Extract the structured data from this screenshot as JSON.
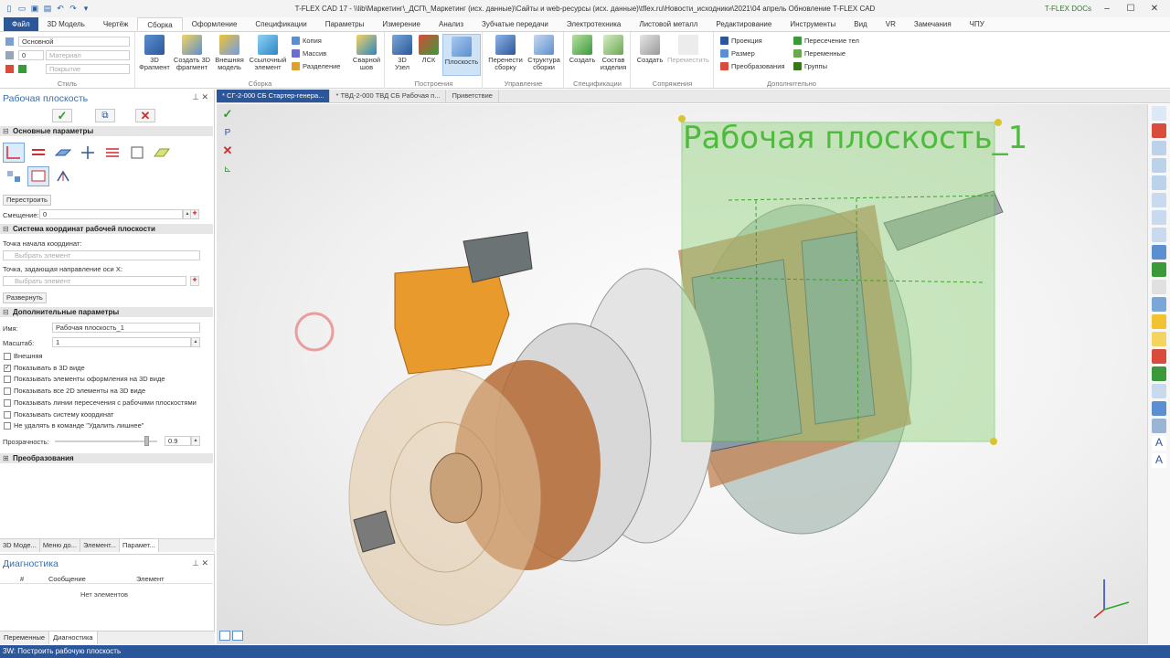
{
  "window": {
    "title": "T-FLEX CAD 17 - \\\\lib\\Маркетинг\\_ДСП\\_Маркетинг (исх. данные)\\Сайты и web-ресурсы (исх. данные)\\tflex.ru\\Новости_исходники\\2021\\04 апрель Обновление T-FLEX CAD",
    "docs_label": "T-FLEX DOCs",
    "min": "–",
    "max": "☐",
    "close": "✕"
  },
  "tabs": [
    "Файл",
    "3D Модель",
    "Чертёж",
    "Сборка",
    "Оформление",
    "Спецификации",
    "Параметры",
    "Измерение",
    "Анализ",
    "Зубчатые передачи",
    "Электротехника",
    "Листовой металл",
    "Редактирование",
    "Инструменты",
    "Вид",
    "VR",
    "Замечания",
    "ЧПУ"
  ],
  "ribbon": {
    "style": {
      "label": "Стиль",
      "layer": "Основной",
      "level": "0",
      "material": "Материал",
      "cover": "Покрытие"
    },
    "assembly": {
      "label": "Сборка",
      "fragment": "3D\nФрагмент",
      "create_fragment": "Создать 3D\nфрагмент",
      "external_model": "Внешняя\nмодель",
      "ref_element": "Ссылочный\nэлемент",
      "copy": "Копия",
      "array": "Массив",
      "split": "Разделение",
      "weld": "Сварной\nшов"
    },
    "constructions": {
      "label": "Построения",
      "node3d": "3D\nУзел",
      "lcs": "ЛСК",
      "plane": "Плоскость"
    },
    "management": {
      "label": "Управление",
      "move": "Перенести\nсборку",
      "structure": "Структура\nсборки"
    },
    "specs": {
      "label": "Спецификации",
      "create": "Создать",
      "composition": "Состав\nизделия"
    },
    "mates": {
      "label": "Сопряжения",
      "create": "Создать",
      "move": "Переместить"
    },
    "extra": {
      "label": "Дополнительно",
      "projection": "Проекция",
      "size": "Размер",
      "transform": "Преобразования",
      "intersection": "Пересечение тел",
      "variables": "Переменные",
      "groups": "Группы"
    }
  },
  "panel": {
    "title": "Рабочая плоскость",
    "section_main": "Основные параметры",
    "rebuild": "Перестроить",
    "offset_label": "Смещение:",
    "offset_value": "0",
    "section_cs": "Система координат рабочей плоскости",
    "origin_label": "Точка начала координат:",
    "origin_placeholder": "Выбрать элемент",
    "xdir_label": "Точка, задающая направление оси X:",
    "xdir_placeholder": "Выбрать элемент",
    "expand": "Развернуть",
    "section_extra": "Дополнительные параметры",
    "name_label": "Имя:",
    "name_value": "Рабочая плоскость_1",
    "scale_label": "Масштаб:",
    "scale_value": "1",
    "checks": [
      {
        "label": "Внешняя",
        "checked": false
      },
      {
        "label": "Показывать в 3D виде",
        "checked": true
      },
      {
        "label": "Показывать элементы оформления на 3D виде",
        "checked": false
      },
      {
        "label": "Показывать все 2D элементы на 3D виде",
        "checked": false
      },
      {
        "label": "Показывать линии пересечения с рабочими плоскостями",
        "checked": false
      },
      {
        "label": "Показывать систему координат",
        "checked": false
      },
      {
        "label": "Не удалять в команде \"Удалить лишнее\"",
        "checked": false
      }
    ],
    "transparency_label": "Прозрачность:",
    "transparency_value": "0.9",
    "transparency": 0.9,
    "section_transforms": "Преобразования",
    "tabs": [
      "3D Моде...",
      "Меню до...",
      "Элемент...",
      "Парамет..."
    ]
  },
  "diagnostics": {
    "title": "Диагностика",
    "col_num": "#",
    "col_msg": "Сообщение",
    "col_elem": "Элемент",
    "empty": "Нет элементов",
    "tabs": [
      "Переменные",
      "Диагностика"
    ]
  },
  "doc_tabs": [
    "* СГ-2-000 СБ Стартер-генера...",
    "* ТВД-2-000 ТВД СБ Рабочая п...",
    "Приветствие"
  ],
  "viewport": {
    "plane_label": "Рабочая плоскость_1",
    "plane_color": "#4dbb3c"
  },
  "status": "3W: Построить рабочую плоскость",
  "colors": {
    "accent": "#2b579a",
    "plane_fill": "#8fd07a",
    "copper": "#c0703a",
    "orange": "#e89a2c"
  }
}
